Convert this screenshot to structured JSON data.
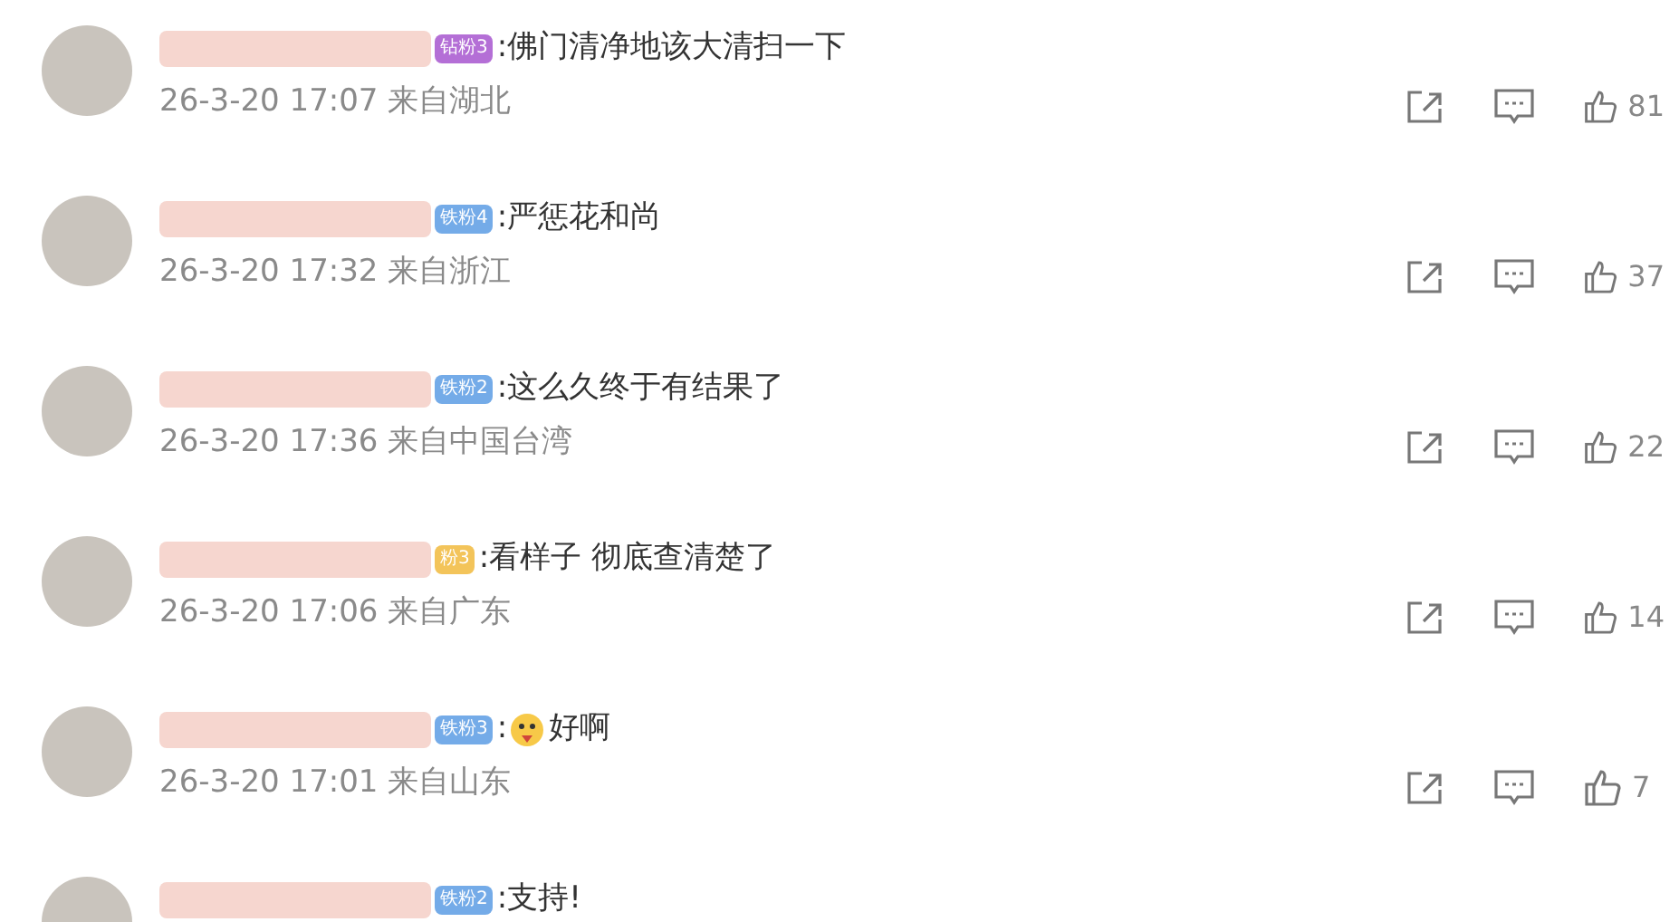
{
  "comments": [
    {
      "badge": {
        "text": "钻粉3",
        "color": "#b46fd6"
      },
      "content": [
        {
          "kind": "text",
          "text": ":佛门清净地该大清扫一下"
        }
      ],
      "meta": "26-3-20 17:07 来自湖北",
      "likes": "81"
    },
    {
      "badge": {
        "text": "铁粉4",
        "color": "#74abe8"
      },
      "content": [
        {
          "kind": "text",
          "text": ":严惩花和尚"
        }
      ],
      "meta": "26-3-20 17:32 来自浙江",
      "likes": "37"
    },
    {
      "badge": {
        "text": "铁粉2",
        "color": "#74abe8"
      },
      "content": [
        {
          "kind": "text",
          "text": ":这么久终于有结果了"
        }
      ],
      "meta": "26-3-20 17:36 来自中国台湾",
      "likes": "22"
    },
    {
      "badge": {
        "text": "粉3",
        "color": "#f3c45a"
      },
      "content": [
        {
          "kind": "text",
          "text": ":看样子 彻底查清楚了"
        }
      ],
      "meta": "26-3-20 17:06 来自广东",
      "likes": "14"
    },
    {
      "badge": {
        "text": "铁粉3",
        "color": "#74abe8"
      },
      "content": [
        {
          "kind": "text",
          "text": ":"
        },
        {
          "kind": "emoji"
        },
        {
          "kind": "text",
          "text": "好啊"
        }
      ],
      "meta": "26-3-20 17:01 来自山东",
      "likes": "7"
    },
    {
      "badge": {
        "text": "铁粉2",
        "color": "#74abe8"
      },
      "content": [
        {
          "kind": "text",
          "text": ":支持!"
        }
      ]
    }
  ]
}
